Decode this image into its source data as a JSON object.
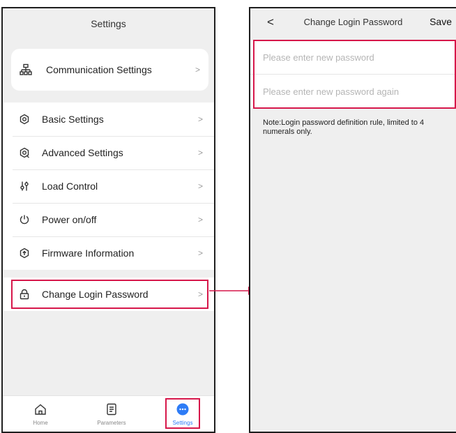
{
  "left_screen": {
    "title": "Settings",
    "communication": {
      "label": "Communication Settings",
      "icon": "network-icon"
    },
    "items": [
      {
        "label": "Basic Settings",
        "icon": "gear-icon"
      },
      {
        "label": "Advanced Settings",
        "icon": "advanced-gear-icon"
      },
      {
        "label": "Load Control",
        "icon": "sliders-icon"
      },
      {
        "label": "Power on/off",
        "icon": "power-icon"
      },
      {
        "label": "Firmware Information",
        "icon": "upload-icon"
      }
    ],
    "change_password": {
      "label": "Change Login Password",
      "icon": "lock-icon"
    },
    "chevron": ">",
    "tabs": [
      {
        "label": "Home",
        "icon": "home-icon"
      },
      {
        "label": "Parameters",
        "icon": "document-icon"
      },
      {
        "label": "Settings",
        "icon": "settings-dots-icon"
      }
    ]
  },
  "right_screen": {
    "back": "<",
    "title": "Change Login Password",
    "save": "Save",
    "new_password_placeholder": "Please enter new password",
    "confirm_password_placeholder": "Please enter new password again",
    "note": "Note:Login password definition rule, limited to 4 numerals only."
  },
  "colors": {
    "highlight": "#d6174a",
    "accent_blue": "#2e7cf6",
    "background": "#efefef"
  }
}
